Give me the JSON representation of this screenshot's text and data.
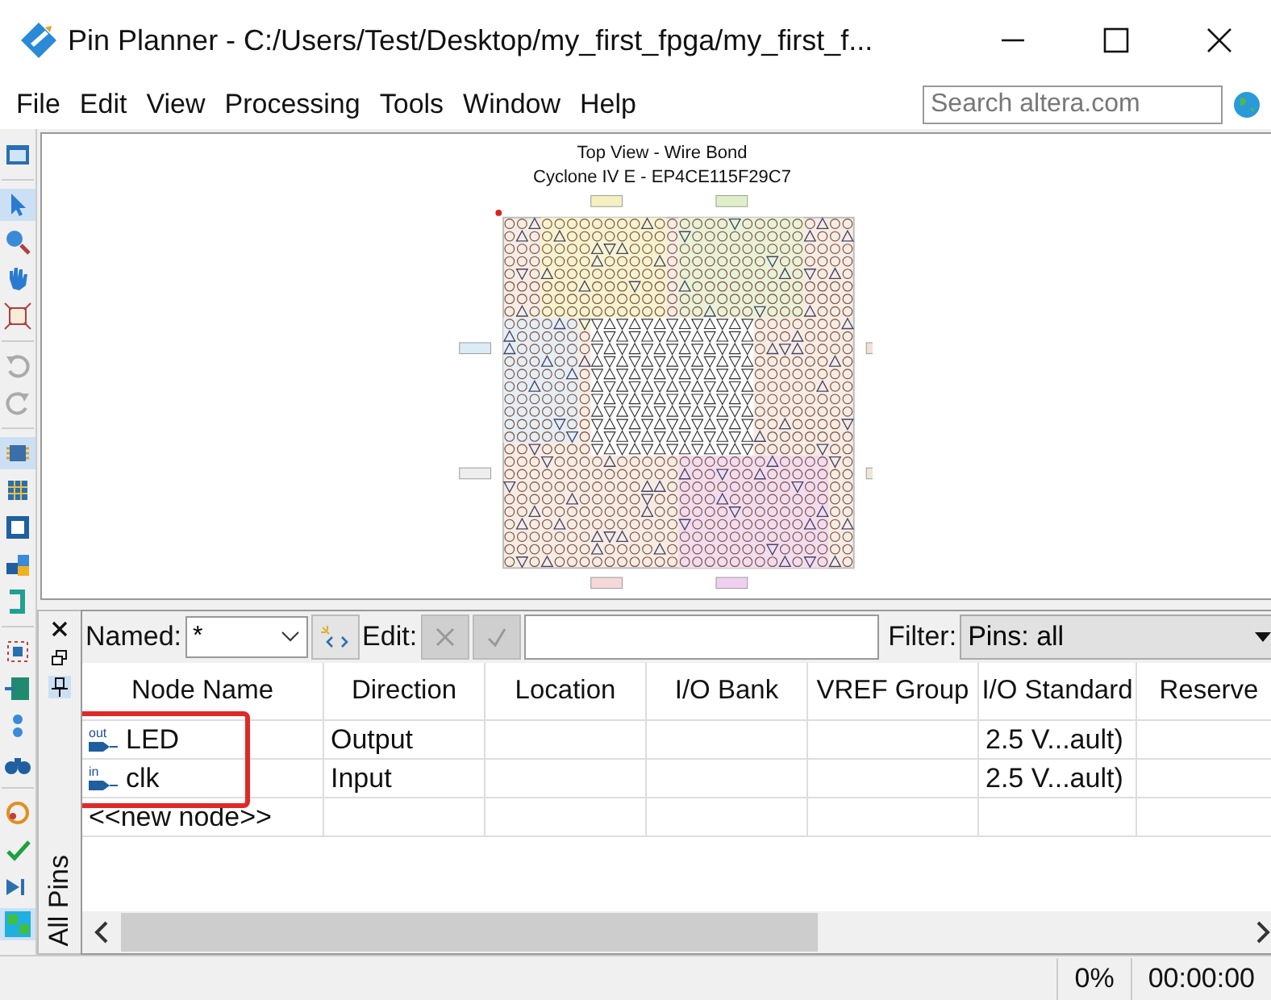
{
  "window": {
    "title": "Pin Planner - C:/Users/Test/Desktop/my_first_fpga/my_first_f..."
  },
  "menu": [
    {
      "label": "File"
    },
    {
      "label": "Edit"
    },
    {
      "label": "View"
    },
    {
      "label": "Processing"
    },
    {
      "label": "Tools"
    },
    {
      "label": "Window"
    },
    {
      "label": "Help"
    }
  ],
  "search": {
    "placeholder": "Search altera.com"
  },
  "package_view": {
    "title": "Top View - Wire Bond",
    "device": "Cyclone IV E - EP4CE115F29C7"
  },
  "pins_pane": {
    "tab": "All Pins",
    "named": {
      "label": "Named:",
      "value": "*"
    },
    "edit": {
      "label": "Edit:"
    },
    "filter": {
      "label": "Filter:",
      "value": "Pins: all"
    },
    "columns": [
      "Node Name",
      "Direction",
      "Location",
      "I/O Bank",
      "VREF Group",
      "I/O Standard",
      "Reserve"
    ],
    "rows": [
      {
        "kind": "pin",
        "badge": "out",
        "node_name": "LED",
        "direction": "Output",
        "io_standard": "2.5 V...ault)",
        "highlighted": true
      },
      {
        "kind": "pin",
        "badge": "in",
        "node_name": "clk",
        "direction": "Input",
        "io_standard": "2.5 V...ault)",
        "highlighted": true
      },
      {
        "kind": "new",
        "node_name": "<<new node>>",
        "highlighted": false
      }
    ]
  },
  "status_bar": {
    "progress": "0%",
    "time": "00:00:00"
  }
}
